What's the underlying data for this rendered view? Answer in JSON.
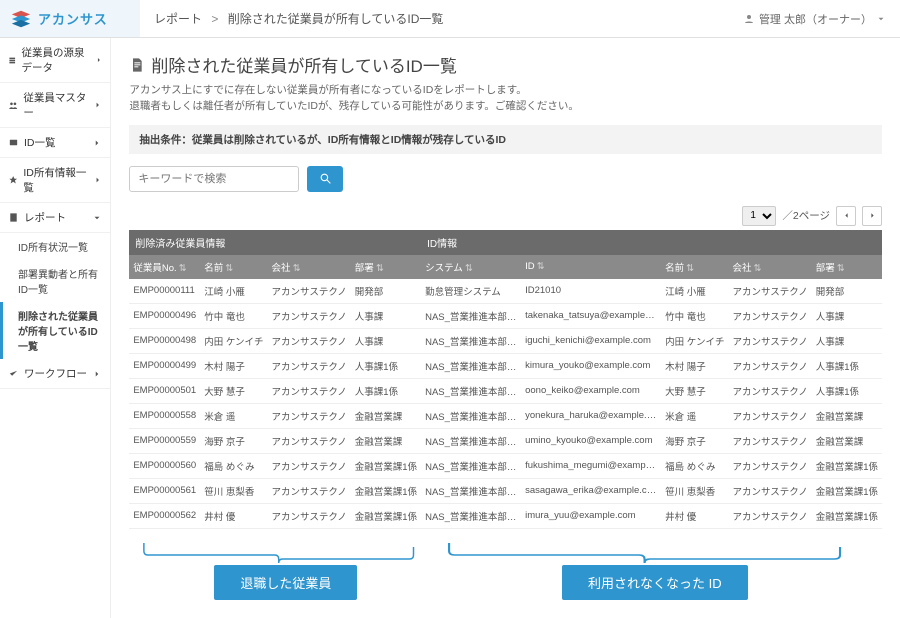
{
  "brand": "アカンサス",
  "breadcrumb": {
    "root": "レポート",
    "sep": ">",
    "page": "削除された従業員が所有しているID一覧"
  },
  "user": {
    "name": "管理 太郎（オーナー）"
  },
  "sidebar": {
    "items": [
      {
        "label": "従業員の源泉データ",
        "chev": "right"
      },
      {
        "label": "従業員マスター",
        "chev": "right"
      },
      {
        "label": "ID一覧",
        "chev": "right"
      },
      {
        "label": "ID所有情報一覧",
        "chev": "right"
      },
      {
        "label": "レポート",
        "chev": "down"
      }
    ],
    "subs": [
      {
        "label": "ID所有状況一覧"
      },
      {
        "label": "部署異動者と所有ID一覧"
      },
      {
        "label": "削除された従業員が所有しているID一覧",
        "active": true
      }
    ],
    "tail": {
      "label": "ワークフロー",
      "chev": "right"
    }
  },
  "page": {
    "title": "削除された従業員が所有しているID一覧",
    "desc1": "アカンサス上にすでに存在しない従業員が所有者になっているIDをレポートします。",
    "desc2": "退職者もしくは離任者が所有していたIDが、残存している可能性があります。ご確認ください。",
    "filter_label": "抽出条件：従業員は削除されているが、ID所有情報とID情報が残存しているID",
    "search_placeholder": "キーワードで検索"
  },
  "pager": {
    "current": "1",
    "total_suffix": "／2ページ"
  },
  "table": {
    "group1": "削除済み従業員情報",
    "group2": "ID情報",
    "cols": [
      "従業員No.",
      "名前",
      "会社",
      "部署",
      "システム",
      "ID",
      "名前",
      "会社",
      "部署"
    ],
    "rows": [
      [
        "EMP00000111",
        "江崎 小雁",
        "アカンサステクノ",
        "開発部",
        "勤怠管理システム",
        "ID21010",
        "江崎 小雁",
        "アカンサステクノ",
        "開発部"
      ],
      [
        "EMP00000496",
        "竹中 竜也",
        "アカンサステクノ",
        "人事課",
        "NAS_営業推進本部_東京",
        "takenaka_tatsuya@example.com",
        "竹中 竜也",
        "アカンサステクノ",
        "人事課"
      ],
      [
        "EMP00000498",
        "内田 ケンイチ",
        "アカンサステクノ",
        "人事課",
        "NAS_営業推進本部_東京",
        "iguchi_kenichi@example.com",
        "内田 ケンイチ",
        "アカンサステクノ",
        "人事課"
      ],
      [
        "EMP00000499",
        "木村 陽子",
        "アカンサステクノ",
        "人事課1係",
        "NAS_営業推進本部_東京",
        "kimura_youko@example.com",
        "木村 陽子",
        "アカンサステクノ",
        "人事課1係"
      ],
      [
        "EMP00000501",
        "大野 慧子",
        "アカンサステクノ",
        "人事課1係",
        "NAS_営業推進本部_東京",
        "oono_keiko@example.com",
        "大野 慧子",
        "アカンサステクノ",
        "人事課1係"
      ],
      [
        "EMP00000558",
        "米倉 遥",
        "アカンサステクノ",
        "金融営業課",
        "NAS_営業推進本部_西日本",
        "yonekura_haruka@example.com",
        "米倉 遥",
        "アカンサステクノ",
        "金融営業課"
      ],
      [
        "EMP00000559",
        "海野 京子",
        "アカンサステクノ",
        "金融営業課",
        "NAS_営業推進本部_西日本",
        "umino_kyouko@example.com",
        "海野 京子",
        "アカンサステクノ",
        "金融営業課"
      ],
      [
        "EMP00000560",
        "福島 めぐみ",
        "アカンサステクノ",
        "金融営業課1係",
        "NAS_営業推進本部_西日本",
        "fukushima_megumi@example.com",
        "福島 めぐみ",
        "アカンサステクノ",
        "金融営業課1係"
      ],
      [
        "EMP00000561",
        "笹川 恵梨香",
        "アカンサステクノ",
        "金融営業課1係",
        "NAS_営業推進本部_西日本",
        "sasagawa_erika@example.com",
        "笹川 恵梨香",
        "アカンサステクノ",
        "金融営業課1係"
      ],
      [
        "EMP00000562",
        "井村 優",
        "アカンサステクノ",
        "金融営業課1係",
        "NAS_営業推進本部_西日本",
        "imura_yuu@example.com",
        "井村 優",
        "アカンサステクノ",
        "金融営業課1係"
      ]
    ]
  },
  "annotations": {
    "left": "退職した従業員",
    "right": "利用されなくなった ID"
  }
}
